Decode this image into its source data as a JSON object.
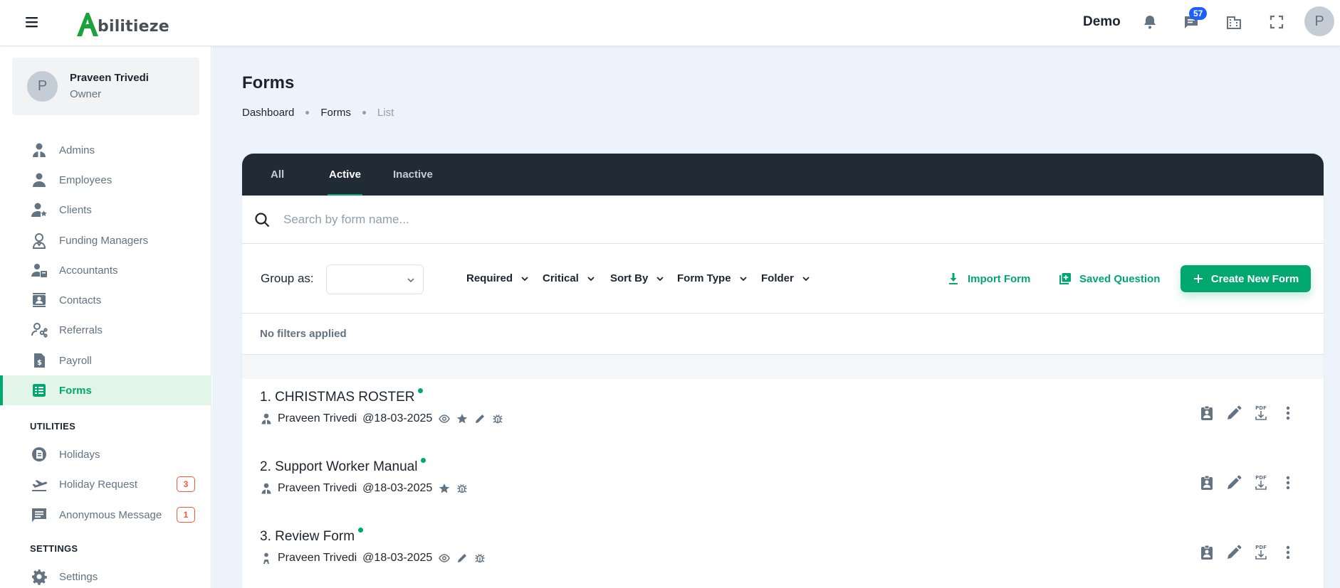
{
  "header": {
    "brand_letter": "A",
    "brand_rest": "bilitieze",
    "workspace": "Demo",
    "chat_badge": "57",
    "avatar_initial": "P"
  },
  "sidebar": {
    "profile": {
      "initial": "P",
      "name": "Praveen Trivedi",
      "role": "Owner"
    },
    "items": [
      {
        "label": "Admins",
        "icon": "admin-icon"
      },
      {
        "label": "Employees",
        "icon": "employee-icon"
      },
      {
        "label": "Clients",
        "icon": "client-icon"
      },
      {
        "label": "Funding Managers",
        "icon": "funding-manager-icon"
      },
      {
        "label": "Accountants",
        "icon": "accountant-icon"
      },
      {
        "label": "Contacts",
        "icon": "contacts-icon"
      },
      {
        "label": "Referrals",
        "icon": "referrals-icon"
      },
      {
        "label": "Payroll",
        "icon": "payroll-icon"
      },
      {
        "label": "Forms",
        "icon": "forms-icon",
        "active": true
      }
    ],
    "utilities_heading": "UTILITIES",
    "utilities": [
      {
        "label": "Holidays",
        "icon": "holidays-icon"
      },
      {
        "label": "Holiday Request",
        "icon": "plane-icon",
        "count": "3"
      },
      {
        "label": "Anonymous Message",
        "icon": "message-icon",
        "count": "1"
      }
    ],
    "settings_heading": "SETTINGS",
    "settings": [
      {
        "label": "Settings",
        "icon": "gear-icon"
      }
    ]
  },
  "page": {
    "title": "Forms",
    "breadcrumbs": [
      "Dashboard",
      "Forms",
      "List"
    ]
  },
  "tabs": [
    "All",
    "Active",
    "Inactive"
  ],
  "active_tab": "Active",
  "search": {
    "placeholder": "Search by form name..."
  },
  "filters": {
    "group_label": "Group as:",
    "group_value": "",
    "dropdowns": [
      "Required",
      "Critical",
      "Sort By",
      "Form Type",
      "Folder"
    ],
    "import_label": "Import Form",
    "saved_question_label": "Saved Question",
    "create_label": "Create New Form",
    "status": "No filters applied"
  },
  "forms": [
    {
      "title": "1. CHRISTMAS ROSTER",
      "author": "Praveen Trivedi",
      "date": "@18-03-2025",
      "tags": [
        "eye-icon",
        "star-icon",
        "pencil-icon",
        "bug-icon"
      ]
    },
    {
      "title": "2. Support Worker Manual",
      "author": "Praveen Trivedi",
      "date": "@18-03-2025",
      "tags": [
        "star-icon",
        "bug-icon"
      ]
    },
    {
      "title": "3. Review Form",
      "author": "Praveen Trivedi",
      "date": "@18-03-2025",
      "tags": [
        "eye-icon",
        "pencil-icon",
        "bug-icon"
      ]
    }
  ],
  "colors": {
    "accent": "#00a76f",
    "tabbar": "#212b36",
    "main_bg": "#edf3fb",
    "badge_blue": "#1e5eff",
    "count_red": "#ff5630"
  }
}
